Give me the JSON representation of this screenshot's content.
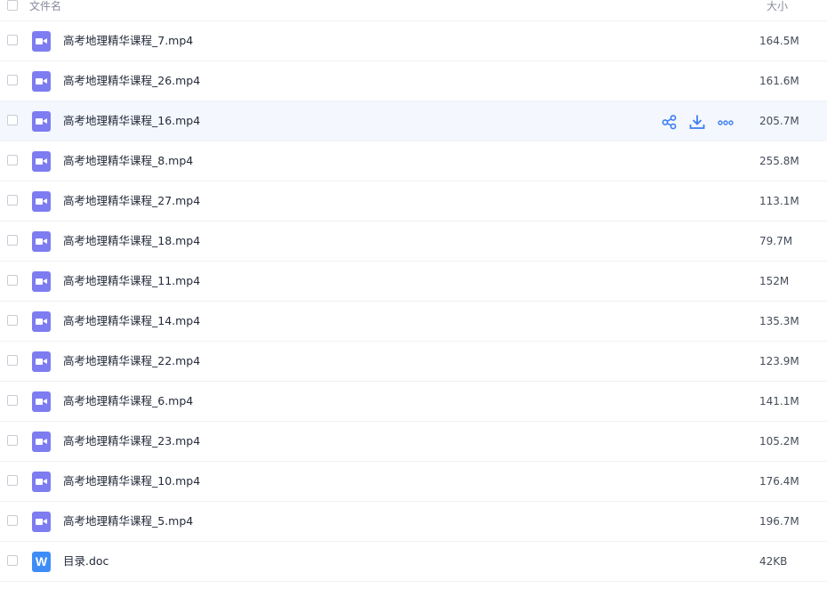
{
  "header": {
    "name_label": "文件名",
    "size_label": "大小"
  },
  "files": [
    {
      "name": "高考地理精华课程_7.mp4",
      "size": "164.5M",
      "type": "video"
    },
    {
      "name": "高考地理精华课程_26.mp4",
      "size": "161.6M",
      "type": "video"
    },
    {
      "name": "高考地理精华课程_16.mp4",
      "size": "205.7M",
      "type": "video",
      "hovered": true
    },
    {
      "name": "高考地理精华课程_8.mp4",
      "size": "255.8M",
      "type": "video"
    },
    {
      "name": "高考地理精华课程_27.mp4",
      "size": "113.1M",
      "type": "video"
    },
    {
      "name": "高考地理精华课程_18.mp4",
      "size": "79.7M",
      "type": "video"
    },
    {
      "name": "高考地理精华课程_11.mp4",
      "size": "152M",
      "type": "video"
    },
    {
      "name": "高考地理精华课程_14.mp4",
      "size": "135.3M",
      "type": "video"
    },
    {
      "name": "高考地理精华课程_22.mp4",
      "size": "123.9M",
      "type": "video"
    },
    {
      "name": "高考地理精华课程_6.mp4",
      "size": "141.1M",
      "type": "video"
    },
    {
      "name": "高考地理精华课程_23.mp4",
      "size": "105.2M",
      "type": "video"
    },
    {
      "name": "高考地理精华课程_10.mp4",
      "size": "176.4M",
      "type": "video"
    },
    {
      "name": "高考地理精华课程_5.mp4",
      "size": "196.7M",
      "type": "video"
    },
    {
      "name": "目录.doc",
      "size": "42KB",
      "type": "doc",
      "icon_letter": "W"
    }
  ],
  "row_actions": {
    "icons": [
      "share-icon",
      "download-icon",
      "more-icon"
    ],
    "color": "#3b7ff0"
  },
  "colors": {
    "video_icon": "#7d7cf1",
    "doc_icon": "#3e8df7",
    "hover_row": "#f4f7fd"
  }
}
